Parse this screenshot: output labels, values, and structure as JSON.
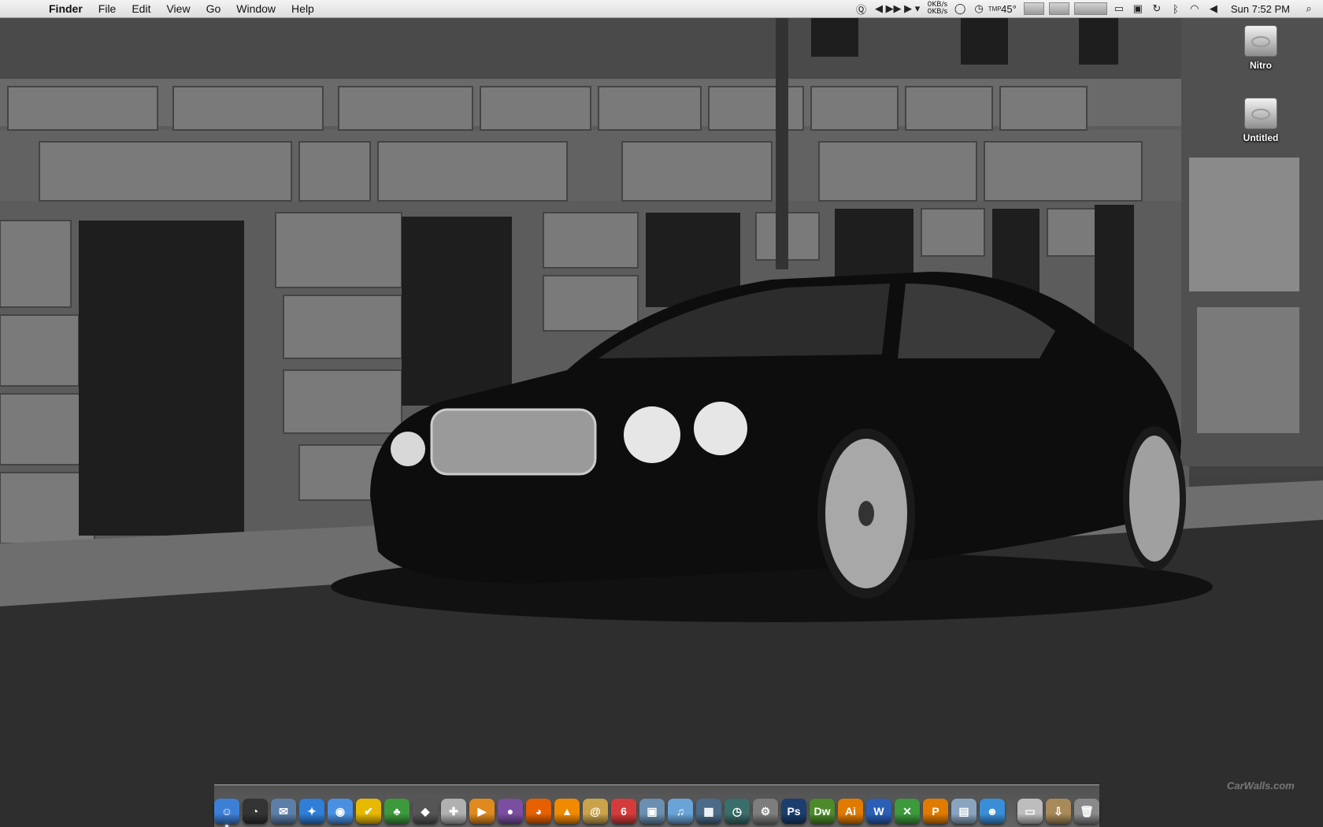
{
  "menubar": {
    "apple_glyph": "",
    "app_name": "Finder",
    "menus": [
      "File",
      "Edit",
      "View",
      "Go",
      "Window",
      "Help"
    ],
    "status": {
      "net_up": "0KB/s",
      "net_down": "0KB/s",
      "temperature": "45°",
      "clock": "Sun 7:52 PM",
      "icons": [
        "quicksilver-icon",
        "itunes-controls-icon",
        "activity-icon",
        "time-machine-icon",
        "cpu-monitor-icon",
        "memory-monitor-icon",
        "display-icon",
        "spaces-icon",
        "sync-icon",
        "bluetooth-icon",
        "wifi-icon",
        "volume-icon",
        "spotlight-icon"
      ]
    }
  },
  "desktop": {
    "volumes": [
      {
        "label": "Nitro"
      },
      {
        "label": "Untitled"
      }
    ],
    "watermark": "CarWalls.com"
  },
  "dock": {
    "apps": [
      {
        "name": "Finder",
        "icon": "finder-icon",
        "glyph": "☺",
        "color": "#3d7fd6",
        "running": true
      },
      {
        "name": "Dashboard",
        "icon": "dashboard-icon",
        "glyph": "◔",
        "color": "#333333",
        "running": false
      },
      {
        "name": "Mail",
        "icon": "mail-icon",
        "glyph": "✉",
        "color": "#5b7fa8",
        "running": false
      },
      {
        "name": "Safari",
        "icon": "safari-icon",
        "glyph": "✦",
        "color": "#2f7ed8",
        "running": false
      },
      {
        "name": "iChat",
        "icon": "ichat-icon",
        "glyph": "◉",
        "color": "#4a90e2",
        "running": false
      },
      {
        "name": "Things",
        "icon": "things-icon",
        "glyph": "✔",
        "color": "#e6b800",
        "running": false
      },
      {
        "name": "Adium",
        "icon": "adium-icon",
        "glyph": "♣",
        "color": "#3c9a3c",
        "running": false
      },
      {
        "name": "Cyberduck",
        "icon": "cyberduck-icon",
        "glyph": "◆",
        "color": "#555555",
        "running": false
      },
      {
        "name": "Disk Utility",
        "icon": "disk-utility-icon",
        "glyph": "✚",
        "color": "#b0b0b0",
        "running": false
      },
      {
        "name": "Transmit",
        "icon": "transmit-icon",
        "glyph": "▶",
        "color": "#e08a1e",
        "running": false
      },
      {
        "name": "Onion Browser",
        "icon": "onion-icon",
        "glyph": "●",
        "color": "#7a4fa0",
        "running": false
      },
      {
        "name": "Firefox",
        "icon": "firefox-icon",
        "glyph": "◕",
        "color": "#e66000",
        "running": false
      },
      {
        "name": "VLC",
        "icon": "vlc-icon",
        "glyph": "▲",
        "color": "#f08a00",
        "running": false
      },
      {
        "name": "Address Book",
        "icon": "address-book-icon",
        "glyph": "@",
        "color": "#c9a24a",
        "running": false
      },
      {
        "name": "iCal",
        "icon": "ical-icon",
        "glyph": "6",
        "color": "#d63b3b",
        "running": false
      },
      {
        "name": "iPhoto",
        "icon": "iphoto-icon",
        "glyph": "▣",
        "color": "#6a8fb0",
        "running": false
      },
      {
        "name": "iTunes",
        "icon": "itunes-icon",
        "glyph": "♫",
        "color": "#6aa3d8",
        "running": false
      },
      {
        "name": "Spaces",
        "icon": "spaces-icon",
        "glyph": "▦",
        "color": "#4b6b8a",
        "running": false
      },
      {
        "name": "Time Machine",
        "icon": "time-machine-icon",
        "glyph": "◷",
        "color": "#3a6e6a",
        "running": false
      },
      {
        "name": "System Preferences",
        "icon": "system-preferences-icon",
        "glyph": "⚙",
        "color": "#7d7d7d",
        "running": false
      },
      {
        "name": "Photoshop",
        "icon": "photoshop-icon",
        "glyph": "Ps",
        "color": "#1b3e6d",
        "running": false
      },
      {
        "name": "Dreamweaver",
        "icon": "dreamweaver-icon",
        "glyph": "Dw",
        "color": "#4d8a2a",
        "running": false
      },
      {
        "name": "Illustrator",
        "icon": "illustrator-icon",
        "glyph": "Ai",
        "color": "#e07b00",
        "running": false
      },
      {
        "name": "Word",
        "icon": "word-icon",
        "glyph": "W",
        "color": "#2a5fb5",
        "running": false
      },
      {
        "name": "Excel",
        "icon": "excel-icon",
        "glyph": "✕",
        "color": "#3c9a3c",
        "running": false
      },
      {
        "name": "PowerPoint",
        "icon": "powerpoint-icon",
        "glyph": "P",
        "color": "#e07b00",
        "running": false
      },
      {
        "name": "Preview",
        "icon": "preview-icon",
        "glyph": "▤",
        "color": "#8aa4c0",
        "running": false
      },
      {
        "name": "Messenger",
        "icon": "messenger-icon",
        "glyph": "☻",
        "color": "#3a8ed8",
        "running": false
      }
    ],
    "stacks": [
      {
        "name": "Documents",
        "icon": "documents-stack-icon",
        "glyph": "▭",
        "color": "#bdbdbd"
      },
      {
        "name": "Downloads",
        "icon": "downloads-stack-icon",
        "glyph": "⇩",
        "color": "#a88a5a"
      },
      {
        "name": "Trash",
        "icon": "trash-icon",
        "glyph": "🗑",
        "color": "#8a8a8a"
      }
    ]
  }
}
